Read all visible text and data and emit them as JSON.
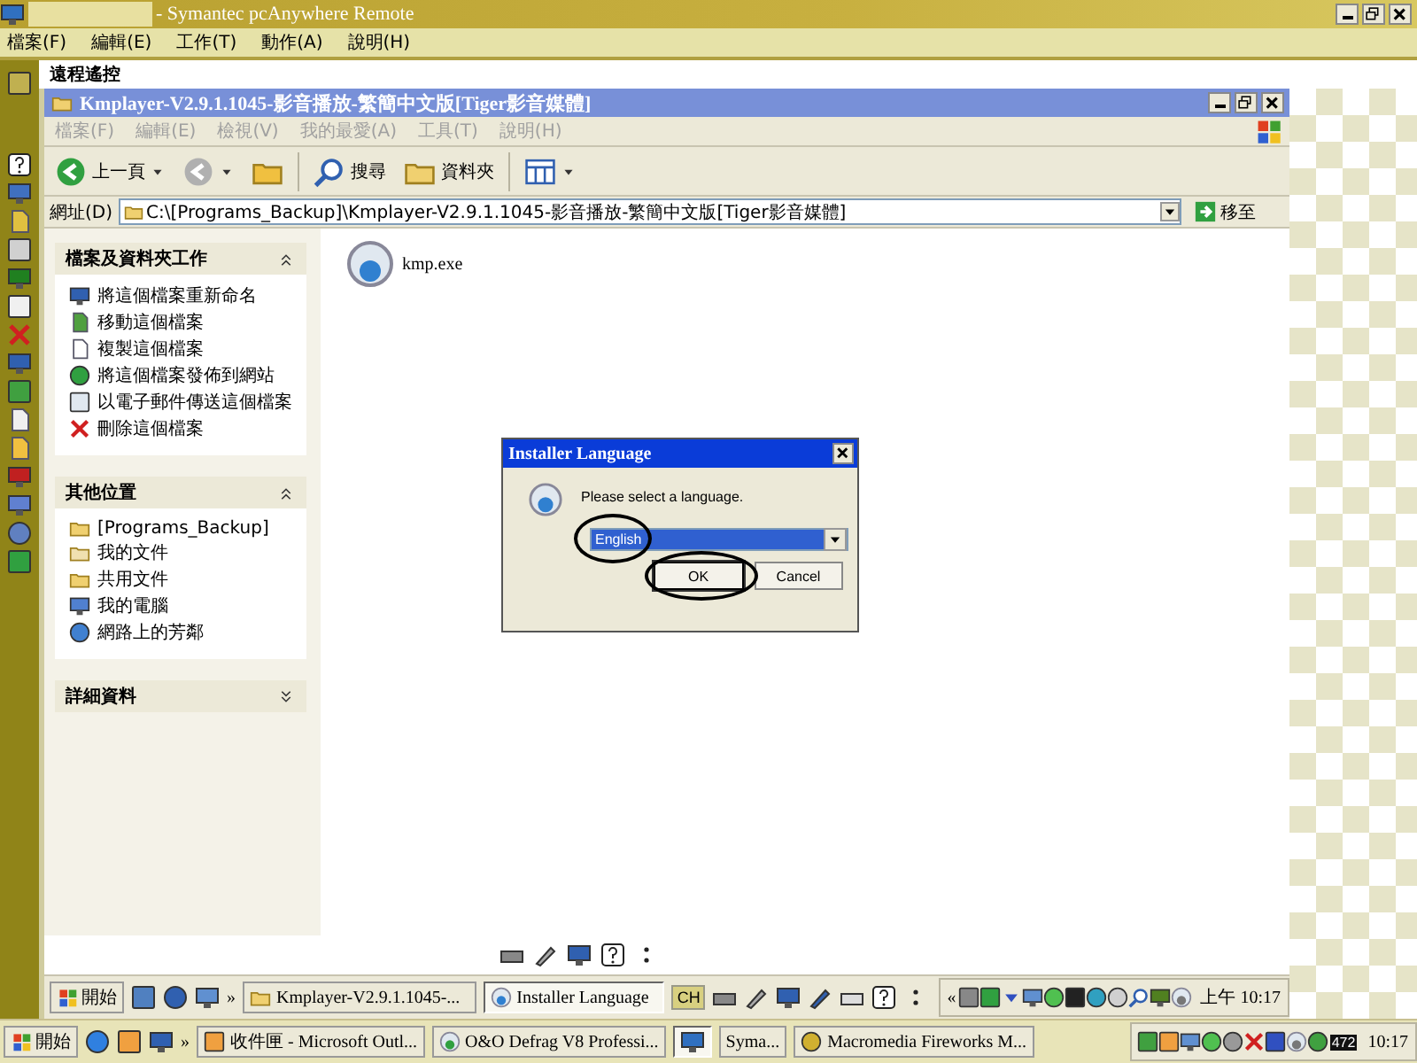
{
  "window": {
    "title": "- Symantec pcAnywhere Remote"
  },
  "menu": [
    "檔案(F)",
    "編輯(E)",
    "工作(T)",
    "動作(A)",
    "說明(H)"
  ],
  "remote_panel": {
    "title": "遠程遙控"
  },
  "explorer": {
    "title": "Kmplayer-V2.9.1.1045-影音播放-繁簡中文版[Tiger影音媒體]",
    "menu": [
      {
        "label": "檔案(F)",
        "disabled": true
      },
      {
        "label": "編輯(E)",
        "disabled": true
      },
      {
        "label": "檢視(V)",
        "disabled": true
      },
      {
        "label": "我的最愛(A)",
        "disabled": true
      },
      {
        "label": "工具(T)",
        "disabled": true
      },
      {
        "label": "說明(H)",
        "disabled": true
      }
    ],
    "toolbar": [
      {
        "kind": "back",
        "label": "上一頁"
      },
      {
        "kind": "forward"
      },
      {
        "kind": "up"
      },
      {
        "kind": "search",
        "label": "搜尋"
      },
      {
        "kind": "folders",
        "label": "資料夾"
      },
      {
        "kind": "views"
      }
    ],
    "address": {
      "label": "網址(D)",
      "value": "C:\\[Programs_Backup]\\Kmplayer-V2.9.1.1045-影音播放-繁簡中文版[Tiger影音媒體]",
      "go": "移至"
    },
    "task_panes": [
      {
        "title": "檔案及資料夾工作",
        "expanded": true,
        "items": [
          "將這個檔案重新命名",
          "移動這個檔案",
          "複製這個檔案",
          "將這個檔案發佈到網站",
          "以電子郵件傳送這個檔案",
          "刪除這個檔案"
        ]
      },
      {
        "title": "其他位置",
        "expanded": true,
        "items": [
          "[Programs_Backup]",
          "我的文件",
          "共用文件",
          "我的電腦",
          "網路上的芳鄰"
        ]
      },
      {
        "title": "詳細資料",
        "expanded": false
      }
    ],
    "files": [
      {
        "name": "kmp.exe"
      }
    ]
  },
  "dialog": {
    "title": "Installer Language",
    "message": "Please select a language.",
    "select": {
      "value": "English",
      "circled": true
    },
    "buttons": [
      {
        "label": "OK",
        "default": true,
        "circled": true
      },
      {
        "label": "Cancel",
        "default": false,
        "circled": false
      }
    ]
  },
  "remote_taskbar": {
    "start": "開始",
    "chevron": "»",
    "tasks": [
      {
        "label": "Kmplayer-V2.9.1.1045-...",
        "selected": false
      },
      {
        "label": "Installer Language",
        "selected": true
      }
    ],
    "ime": "CH",
    "tray_chevron": "«",
    "clock": "上午 10:17"
  },
  "taskbar": {
    "start": "開始",
    "chevron": "»",
    "tasks": [
      {
        "kind": "text",
        "label": "收件匣 - Microsoft Outl...",
        "selected": false
      },
      {
        "kind": "text",
        "label": "O&O Defrag V8 Professi...",
        "selected": false
      },
      {
        "kind": "icon",
        "selected": true
      },
      {
        "kind": "text",
        "label": "Syma...",
        "selected": false
      },
      {
        "kind": "text",
        "label": "Macromedia Fireworks M...",
        "selected": false
      }
    ],
    "tray_badge": "472",
    "clock": "10:17"
  }
}
